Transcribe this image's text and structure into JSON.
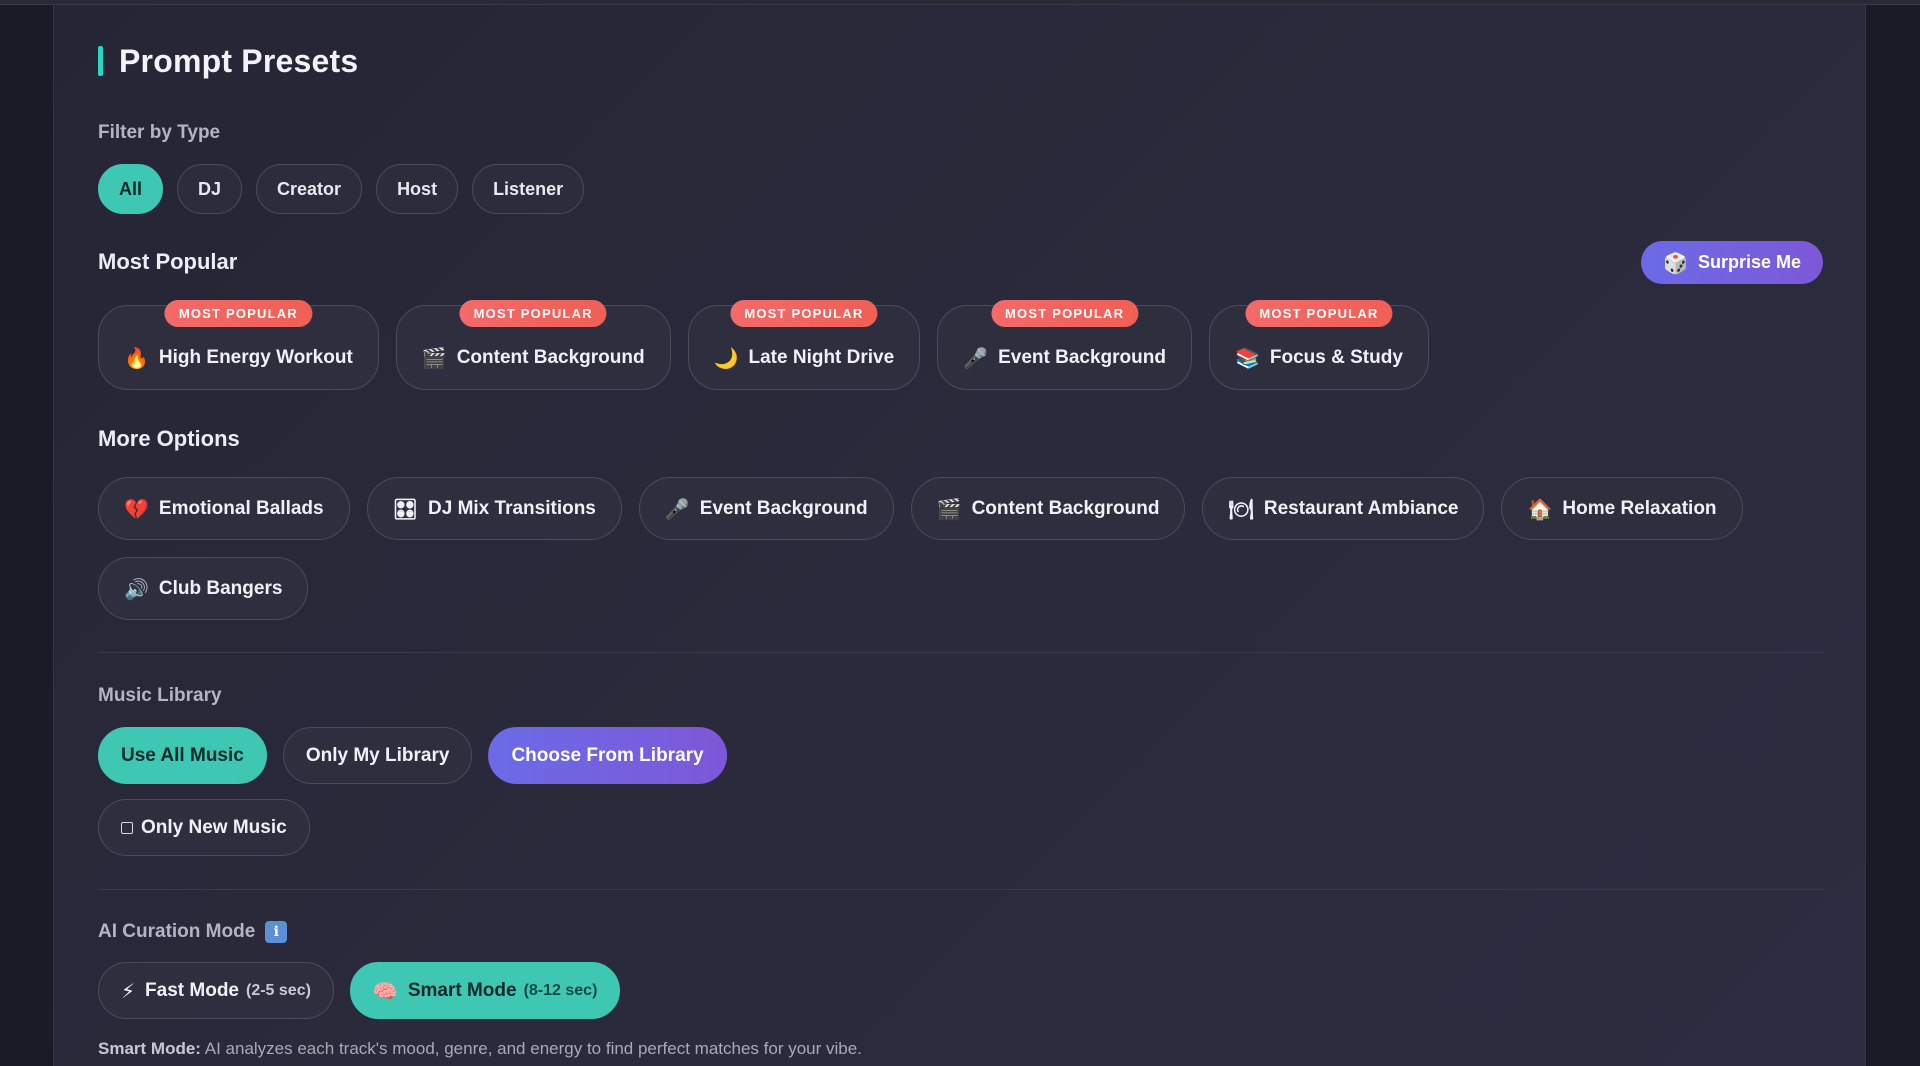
{
  "title": "Prompt Presets",
  "filter": {
    "label": "Filter by Type",
    "chips": [
      "All",
      "DJ",
      "Creator",
      "Host",
      "Listener"
    ],
    "active": "All"
  },
  "popular": {
    "heading": "Most Popular",
    "badge": "MOST POPULAR",
    "surprise_icon": "🎲",
    "surprise_label": "Surprise Me",
    "items": [
      {
        "icon": "🔥",
        "label": "High Energy Workout"
      },
      {
        "icon": "🎬",
        "label": "Content Background"
      },
      {
        "icon": "🌙",
        "label": "Late Night Drive"
      },
      {
        "icon": "🎤",
        "label": "Event Background"
      },
      {
        "icon": "📚",
        "label": "Focus & Study"
      }
    ]
  },
  "more": {
    "heading": "More Options",
    "items": [
      {
        "icon": "💔",
        "label": "Emotional Ballads"
      },
      {
        "icon": "🎛",
        "label": "DJ Mix Transitions"
      },
      {
        "icon": "🎤",
        "label": "Event Background"
      },
      {
        "icon": "🎬",
        "label": "Content Background"
      },
      {
        "icon": "🍽",
        "label": "Restaurant Ambiance"
      },
      {
        "icon": "🏠",
        "label": "Home Relaxation"
      },
      {
        "icon": "🔊",
        "label": "Club Bangers"
      }
    ]
  },
  "library": {
    "label": "Music Library",
    "use_all": "Use All Music",
    "only_mine": "Only My Library",
    "choose": "Choose From Library",
    "only_new": "Only New Music"
  },
  "curation": {
    "label": "AI Curation Mode",
    "info_icon": "i",
    "fast_icon": "⚡",
    "fast_label": "Fast Mode",
    "fast_time": "(2-5 sec)",
    "smart_icon": "🧠",
    "smart_label": "Smart Mode",
    "smart_time": "(8-12 sec)",
    "desc_label": "Smart Mode:",
    "desc_text": " AI analyzes each track's mood, genre, and energy to find perfect matches for your vibe."
  }
}
